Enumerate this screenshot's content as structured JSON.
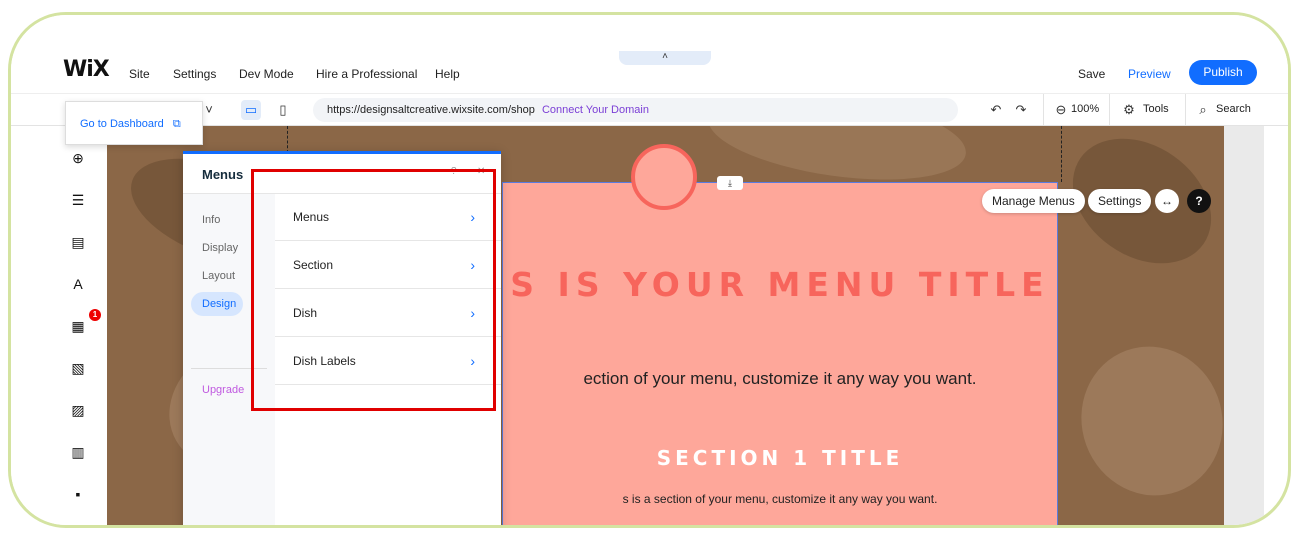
{
  "topbar": {
    "logo": "WiX",
    "menu": [
      "Site",
      "Settings",
      "Dev Mode",
      "Hire a Professional",
      "Help"
    ],
    "collapse_icon": "chevron-up-icon",
    "collapse_glyph": "˄",
    "save": "Save",
    "preview": "Preview",
    "publish": "Publish"
  },
  "toolbar": {
    "url": "https://designsaltcreative.wixsite.com/shop",
    "connect_domain": "Connect Your Domain",
    "zoom": "100%",
    "tools": "Tools",
    "search": "Search",
    "glyphs": {
      "dropdown": "˅",
      "desktop": "▭",
      "mobile": "▯",
      "undo": "↶",
      "redo": "↷",
      "zoom": "⊖",
      "tools": "⚙",
      "search": "⌕"
    }
  },
  "dashboard_tooltip": {
    "label": "Go to Dashboard",
    "icon_glyph": "⧉"
  },
  "leftbar": {
    "icons": [
      {
        "name": "add-elements-icon",
        "glyph": "⊕"
      },
      {
        "name": "pages-menu-icon",
        "glyph": "☰"
      },
      {
        "name": "site-pages-icon",
        "glyph": "▤"
      },
      {
        "name": "theme-design-icon",
        "glyph": "A"
      },
      {
        "name": "add-apps-icon",
        "glyph": "▦"
      },
      {
        "name": "business-tools-icon",
        "glyph": "▧"
      },
      {
        "name": "media-icon",
        "glyph": "▨"
      },
      {
        "name": "table-icon",
        "glyph": "▥"
      },
      {
        "name": "portfolio-icon",
        "glyph": "▪"
      }
    ],
    "apps_badge": "1"
  },
  "panel": {
    "title": "Menus",
    "help_glyph": "?",
    "close_glyph": "✕",
    "nav": [
      "Info",
      "Display",
      "Layout",
      "Design"
    ],
    "active_nav": "Design",
    "upgrade": "Upgrade",
    "list": [
      "Menus",
      "Section",
      "Dish",
      "Dish Labels"
    ],
    "chevron_glyph": "›"
  },
  "canvas": {
    "menu_title": "S IS YOUR MENU TITLE",
    "menu_desc": "ection of your menu, customize it any way you want.",
    "section_title": "SECTION 1 TITLE",
    "section_desc": "s is a section of your menu, customize it any way you want.",
    "anchor_glyph": "⤓",
    "manage_menus": "Manage Menus",
    "settings": "Settings",
    "stretch_glyph": "↔",
    "help_glyph": "?"
  },
  "colors": {
    "accent": "#116dff",
    "menu_bg": "#fea79a",
    "title_coral": "#f7655c",
    "highlight": "#e00000",
    "frame": "#d4e3a1"
  }
}
